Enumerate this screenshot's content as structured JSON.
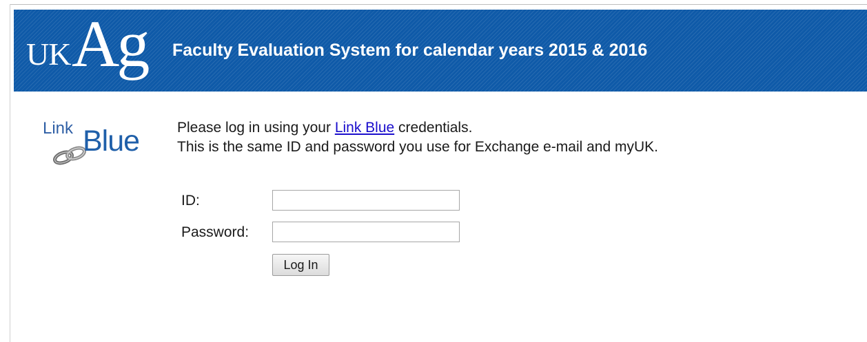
{
  "banner": {
    "logo_uk": "UK",
    "logo_ag": "Ag",
    "title": "Faculty Evaluation System for calendar years 2015 & 2016",
    "color": "#0f5aa8"
  },
  "linkblue_logo": {
    "link_text": "Link",
    "blue_text": "Blue",
    "icon": "chain-link-icon"
  },
  "intro": {
    "line1_prefix": "Please log in using your ",
    "line1_link": "Link Blue",
    "line1_suffix": " credentials.",
    "line2": "This is the same ID and password you use for Exchange e-mail and myUK."
  },
  "form": {
    "id_label": "ID:",
    "id_value": "",
    "password_label": "Password:",
    "password_value": "",
    "submit_label": "Log In"
  }
}
